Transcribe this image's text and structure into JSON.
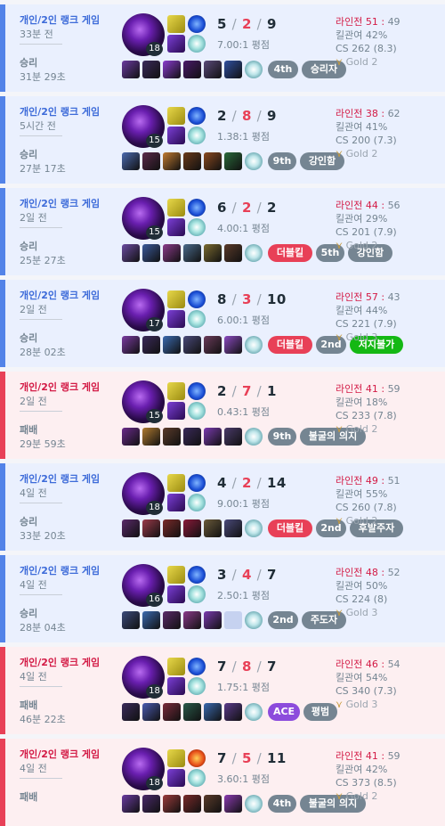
{
  "games": [
    {
      "result": "win",
      "game_type": "개인/2인 랭크 게임",
      "ago": "33분 전",
      "result_label": "승리",
      "duration": "31분 29초",
      "level": "18",
      "kills": "5",
      "deaths": "2",
      "assists": "9",
      "kda_ratio": "7.00:1 평점",
      "lane_label": "라인전 51",
      "lane_value": "49",
      "kill_participation": "킬관여 42%",
      "cs": "CS 262 (8.3)",
      "tier": "Gold 2",
      "spell2": "flash",
      "items": [
        "#6b3aa0",
        "#3a2a5a",
        "#8a3ad0",
        "#4a1a6a",
        "#5a4a7a",
        "#3050a0",
        "#2a1a4a"
      ],
      "tags": [
        {
          "text": "4th",
          "color": "gray",
          "w": 34
        },
        {
          "text": "승리자",
          "color": "gray",
          "w": 50
        }
      ]
    },
    {
      "result": "win",
      "game_type": "개인/2인 랭크 게임",
      "ago": "5시간 전",
      "result_label": "승리",
      "duration": "27분 17초",
      "level": "15",
      "kills": "2",
      "deaths": "8",
      "assists": "9",
      "kda_ratio": "1.38:1 평점",
      "lane_label": "라인전 38",
      "lane_value": "62",
      "kill_participation": "킬관여 41%",
      "cs": "CS 200 (7.3)",
      "tier": "Gold 2",
      "spell2": "flash",
      "items": [
        "#4a6ab0",
        "#5a2a4a",
        "#c07a30",
        "#6a3a1a",
        "#8a4a20",
        "#2a6a3a",
        "#3a2a6a"
      ],
      "tags": [
        {
          "text": "9th",
          "color": "gray",
          "w": 32
        },
        {
          "text": "강인함",
          "color": "gray",
          "w": 50
        }
      ]
    },
    {
      "result": "win",
      "game_type": "개인/2인 랭크 게임",
      "ago": "2일 전",
      "result_label": "승리",
      "duration": "25분 27초",
      "level": "15",
      "kills": "6",
      "deaths": "2",
      "assists": "2",
      "kda_ratio": "4.00:1 평점",
      "lane_label": "라인전 44",
      "lane_value": "56",
      "kill_participation": "킬관여 29%",
      "cs": "CS 201 (7.9)",
      "tier": "Gold 2",
      "spell2": "flash",
      "items": [
        "#6a4aa0",
        "#3a5a9a",
        "#8a3a8a",
        "#4a6a8a",
        "#7a6a30",
        "#5a3a2a",
        "#4a2a6a"
      ],
      "tags": [
        {
          "text": "더블킬",
          "color": "red",
          "w": 50
        },
        {
          "text": "5th",
          "color": "gray",
          "w": 32
        },
        {
          "text": "강인함",
          "color": "gray",
          "w": 50
        }
      ]
    },
    {
      "result": "win",
      "game_type": "개인/2인 랭크 게임",
      "ago": "2일 전",
      "result_label": "승리",
      "duration": "28분 02초",
      "level": "17",
      "kills": "8",
      "deaths": "3",
      "assists": "10",
      "kda_ratio": "6.00:1 평점",
      "lane_label": "라인전 57",
      "lane_value": "43",
      "kill_participation": "킬관여 44%",
      "cs": "CS 221 (7.9)",
      "tier": "Gold 3",
      "spell2": "flash",
      "items": [
        "#7a3aa0",
        "#3a2a5a",
        "#3a6ab0",
        "#4a4a7a",
        "#6a3a5a",
        "#8a4ac0",
        "#2a1a4a"
      ],
      "tags": [
        {
          "text": "더블킬",
          "color": "red",
          "w": 50
        },
        {
          "text": "2nd",
          "color": "gray",
          "w": 34
        },
        {
          "text": "저지불가",
          "color": "green",
          "w": 60
        }
      ]
    },
    {
      "result": "loss",
      "game_type": "개인/2인 랭크 게임",
      "ago": "2일 전",
      "result_label": "패배",
      "duration": "29분 59초",
      "level": "15",
      "kills": "2",
      "deaths": "7",
      "assists": "1",
      "kda_ratio": "0.43:1 평점",
      "lane_label": "라인전 41",
      "lane_value": "59",
      "kill_participation": "킬관여 18%",
      "cs": "CS 233 (7.8)",
      "tier": "Gold 2",
      "spell2": "flash",
      "items": [
        "#6a2a8a",
        "#b07a30",
        "#5a3a2a",
        "#3a2a5a",
        "#7a3ab0",
        "#4a3a6a",
        "#2a1a4a"
      ],
      "tags": [
        {
          "text": "9th",
          "color": "gray",
          "w": 32
        },
        {
          "text": "불굴의 의지",
          "color": "gray",
          "w": 74
        }
      ]
    },
    {
      "result": "win",
      "game_type": "개인/2인 랭크 게임",
      "ago": "4일 전",
      "result_label": "승리",
      "duration": "33분 20초",
      "level": "18",
      "kills": "4",
      "deaths": "2",
      "assists": "14",
      "kda_ratio": "9.00:1 평점",
      "lane_label": "라인전 49",
      "lane_value": "51",
      "kill_participation": "킬관여 55%",
      "cs": "CS 260 (7.8)",
      "tier": "Gold 2",
      "spell2": "flash",
      "items": [
        "#5a2a6a",
        "#9a3a4a",
        "#7a2a2a",
        "#8a1a3a",
        "#6a5a3a",
        "#4a4a7a",
        "#2a1a4a"
      ],
      "tags": [
        {
          "text": "더블킬",
          "color": "red",
          "w": 50
        },
        {
          "text": "2nd",
          "color": "gray",
          "w": 34
        },
        {
          "text": "후발주자",
          "color": "gray",
          "w": 60
        }
      ]
    },
    {
      "result": "win",
      "game_type": "개인/2인 랭크 게임",
      "ago": "4일 전",
      "result_label": "승리",
      "duration": "28분 04초",
      "level": "16",
      "kills": "3",
      "deaths": "4",
      "assists": "7",
      "kda_ratio": "2.50:1 평점",
      "lane_label": "라인전 48",
      "lane_value": "52",
      "kill_participation": "킬관여 50%",
      "cs": "CS 224 (8)",
      "tier": "Gold 3",
      "spell2": "flash",
      "items": [
        "#3a4a7a",
        "#3a6ab0",
        "#5a2a6a",
        "#8a3a8a",
        "#7a3ab0",
        "",
        "#2a1a4a"
      ],
      "tags": [
        {
          "text": "2nd",
          "color": "gray",
          "w": 34
        },
        {
          "text": "주도자",
          "color": "gray",
          "w": 50
        }
      ]
    },
    {
      "result": "loss",
      "game_type": "개인/2인 랭크 게임",
      "ago": "4일 전",
      "result_label": "패배",
      "duration": "46분 22초",
      "level": "18",
      "kills": "7",
      "deaths": "8",
      "assists": "7",
      "kda_ratio": "1.75:1 평점",
      "lane_label": "라인전 46",
      "lane_value": "54",
      "kill_participation": "킬관여 54%",
      "cs": "CS 340 (7.3)",
      "tier": "Gold 3",
      "spell2": "flash",
      "items": [
        "#3a2a5a",
        "#4a5ab0",
        "#7a2a3a",
        "#2a5a4a",
        "#3a6ab0",
        "#5a3a8a",
        "#2a1a4a"
      ],
      "tags": [
        {
          "text": "ACE",
          "color": "purple",
          "w": 36
        },
        {
          "text": "평범",
          "color": "gray",
          "w": 38
        }
      ]
    },
    {
      "result": "loss",
      "game_type": "개인/2인 랭크 게임",
      "ago": "4일 전",
      "result_label": "패배",
      "duration": "",
      "level": "18",
      "kills": "7",
      "deaths": "5",
      "assists": "11",
      "kda_ratio": "3.60:1 평점",
      "lane_label": "라인전 41",
      "lane_value": "59",
      "kill_participation": "킬관여 42%",
      "cs": "CS 373 (8.5)",
      "tier": "Gold 2",
      "spell2": "ignite",
      "items": [
        "#6a3aa0",
        "#4a2a6a",
        "#9a3a3a",
        "#7a2a2a",
        "#5a3a2a",
        "#8a3ab0",
        "#2a1a4a"
      ],
      "tags": [
        {
          "text": "4th",
          "color": "gray",
          "w": 32
        },
        {
          "text": "불굴의 의지",
          "color": "gray",
          "w": 74
        }
      ]
    }
  ]
}
